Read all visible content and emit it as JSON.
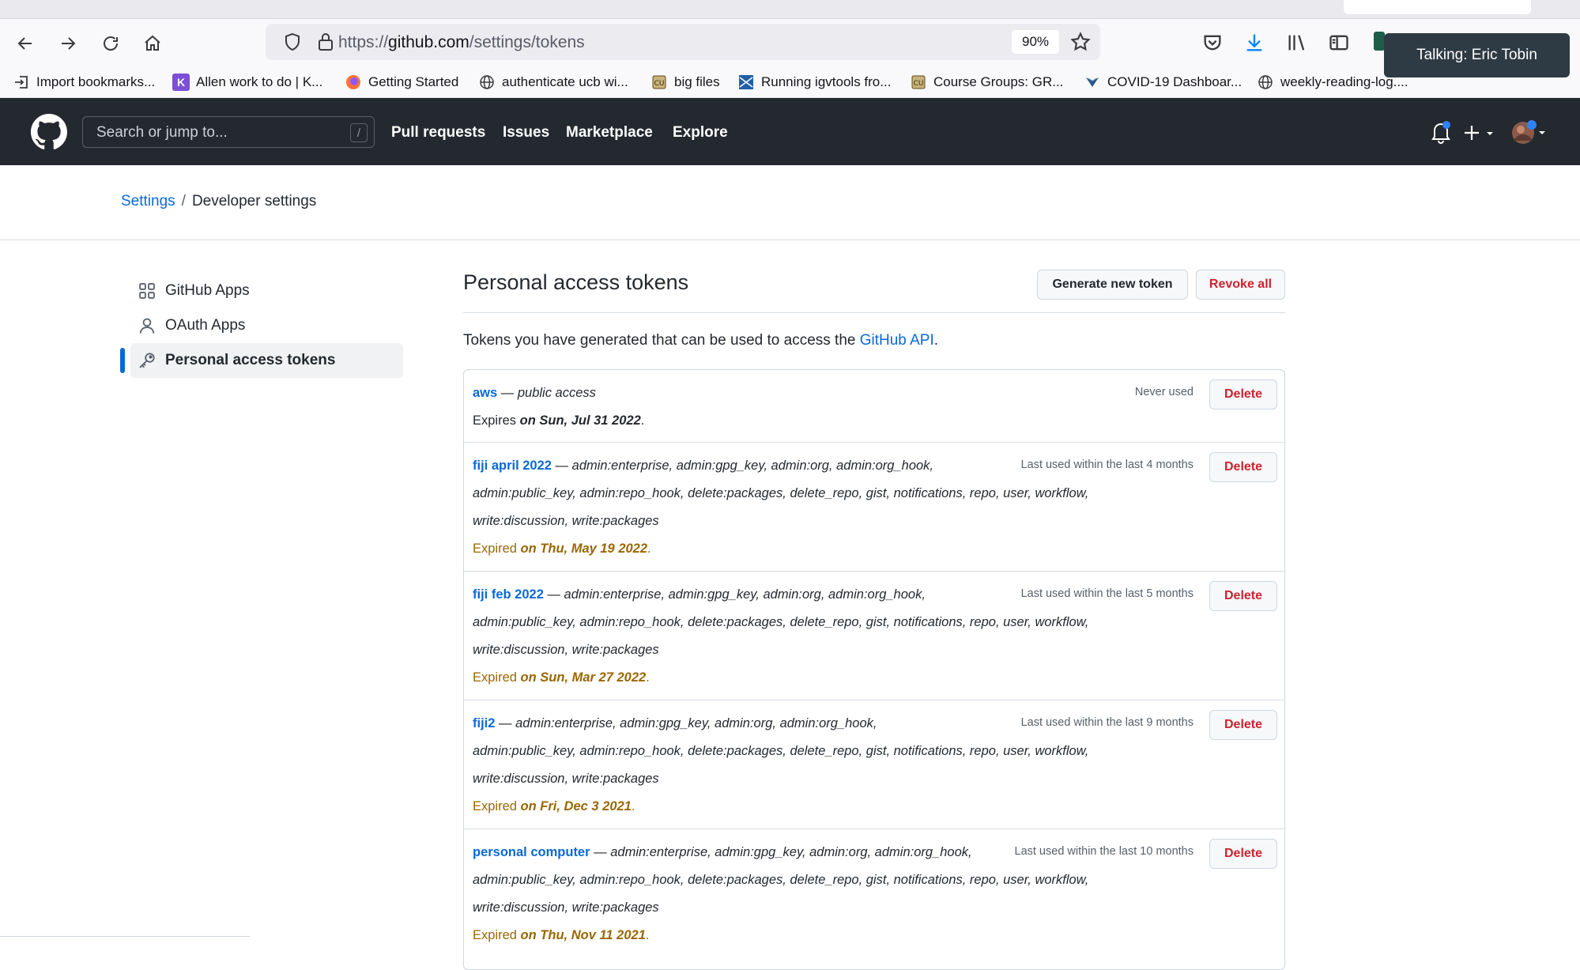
{
  "browser": {
    "url_prefix": "https://",
    "url_host": "github.com",
    "url_path": "/settings/tokens",
    "zoom": "90%",
    "talking_popup": "Talking: Eric Tobin",
    "bookmarks": [
      {
        "label": "Import bookmarks...",
        "icon": "import-icon"
      },
      {
        "label": "Allen work to do | K...",
        "icon": "k-icon"
      },
      {
        "label": "Getting Started",
        "icon": "firefox-icon"
      },
      {
        "label": "authenticate ucb wi...",
        "icon": "globe-icon"
      },
      {
        "label": "big files",
        "icon": "seal-icon"
      },
      {
        "label": "Running igvtools fro...",
        "icon": "igv-icon"
      },
      {
        "label": "Course Groups: GR...",
        "icon": "seal-icon"
      },
      {
        "label": "COVID-19 Dashboar...",
        "icon": "covid-icon"
      },
      {
        "label": "weekly-reading-log....",
        "icon": "globe-icon"
      }
    ],
    "overflow": "»"
  },
  "github_header": {
    "search_placeholder": "Search or jump to...",
    "search_key": "/",
    "nav": [
      "Pull requests",
      "Issues",
      "Marketplace",
      "Explore"
    ]
  },
  "breadcrumb": {
    "parent": "Settings",
    "separator": "/",
    "current": "Developer settings"
  },
  "sidebar": {
    "items": [
      {
        "label": "GitHub Apps",
        "icon": "apps-grid-icon"
      },
      {
        "label": "OAuth Apps",
        "icon": "person-icon"
      },
      {
        "label": "Personal access tokens",
        "icon": "key-icon",
        "active": true
      }
    ]
  },
  "main": {
    "title": "Personal access tokens",
    "generate_button": "Generate new token",
    "revoke_button": "Revoke all",
    "intro_text": "Tokens you have generated that can be used to access the ",
    "intro_link": "GitHub API",
    "intro_end": ".",
    "delete_label": "Delete",
    "tokens": [
      {
        "name": "aws",
        "scope_line1": "public access",
        "scope_line2": "",
        "scope_line3": "",
        "usage": "Never used",
        "expiry_prefix": "Expires",
        "expiry_date": "on Sun, Jul 31 2022",
        "expired": false
      },
      {
        "name": "fiji april 2022",
        "scope_line1": "admin:enterprise, admin:gpg_key, admin:org, admin:org_hook,",
        "scope_line2": "admin:public_key, admin:repo_hook, delete:packages, delete_repo, gist, notifications, repo, user, workflow,",
        "scope_line3": "write:discussion, write:packages",
        "usage": "Last used within the last 4 months",
        "expiry_prefix": "Expired",
        "expiry_date": "on Thu, May 19 2022",
        "expired": true
      },
      {
        "name": "fiji feb 2022",
        "scope_line1": "admin:enterprise, admin:gpg_key, admin:org, admin:org_hook,",
        "scope_line2": "admin:public_key, admin:repo_hook, delete:packages, delete_repo, gist, notifications, repo, user, workflow,",
        "scope_line3": "write:discussion, write:packages",
        "usage": "Last used within the last 5 months",
        "expiry_prefix": "Expired",
        "expiry_date": "on Sun, Mar 27 2022",
        "expired": true
      },
      {
        "name": "fiji2",
        "scope_line1": "admin:enterprise, admin:gpg_key, admin:org, admin:org_hook,",
        "scope_line2": "admin:public_key, admin:repo_hook, delete:packages, delete_repo, gist, notifications, repo, user, workflow,",
        "scope_line3": "write:discussion, write:packages",
        "usage": "Last used within the last 9 months",
        "expiry_prefix": "Expired",
        "expiry_date": "on Fri, Dec 3 2021",
        "expired": true
      },
      {
        "name": "personal computer",
        "scope_line1": "admin:enterprise, admin:gpg_key, admin:org, admin:org_hook,",
        "scope_line2": "admin:public_key, admin:repo_hook, delete:packages, delete_repo, gist, notifications, repo, user, workflow,",
        "scope_line3": "write:discussion, write:packages",
        "usage": "Last used within the last 10 months",
        "expiry_prefix": "Expired",
        "expiry_date": "on Thu, Nov 11 2021",
        "expired": true
      }
    ]
  },
  "colors": {
    "link": "#0969da",
    "danger": "#cf222e",
    "expired": "#9a6700",
    "header_bg": "#24292f"
  }
}
